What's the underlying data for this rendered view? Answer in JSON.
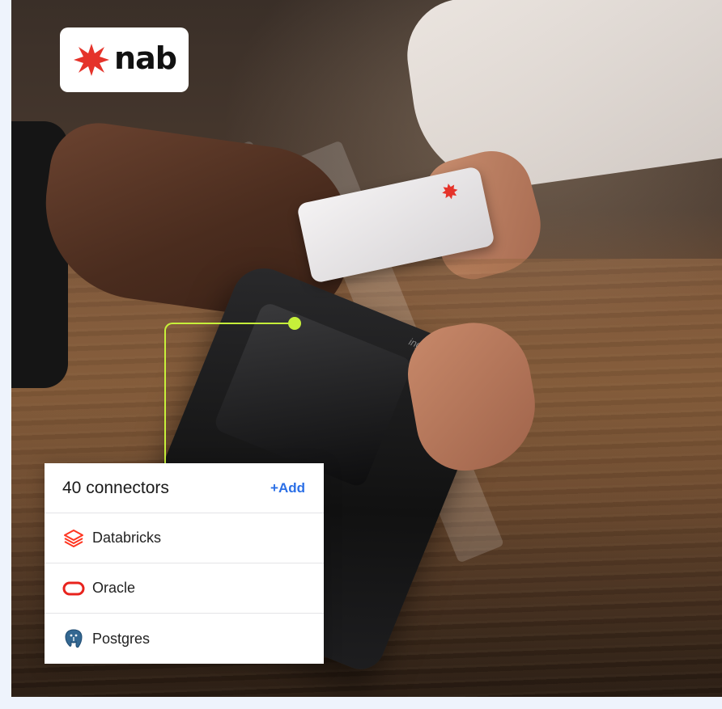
{
  "logo": {
    "text": "nab",
    "accent_color": "#e5332a"
  },
  "panel": {
    "title": "40 connectors",
    "add_label": "+Add",
    "add_color": "#2b6fe6",
    "connectors": [
      {
        "label": "Databricks",
        "icon": "databricks-icon",
        "color": "#ff3621"
      },
      {
        "label": "Oracle",
        "icon": "oracle-icon",
        "color": "#e8231d"
      },
      {
        "label": "Postgres",
        "icon": "postgres-icon",
        "color": "#336791"
      }
    ]
  },
  "connector_line_color": "#c6f03a",
  "photo": {
    "terminal_brand": "ingenico"
  }
}
